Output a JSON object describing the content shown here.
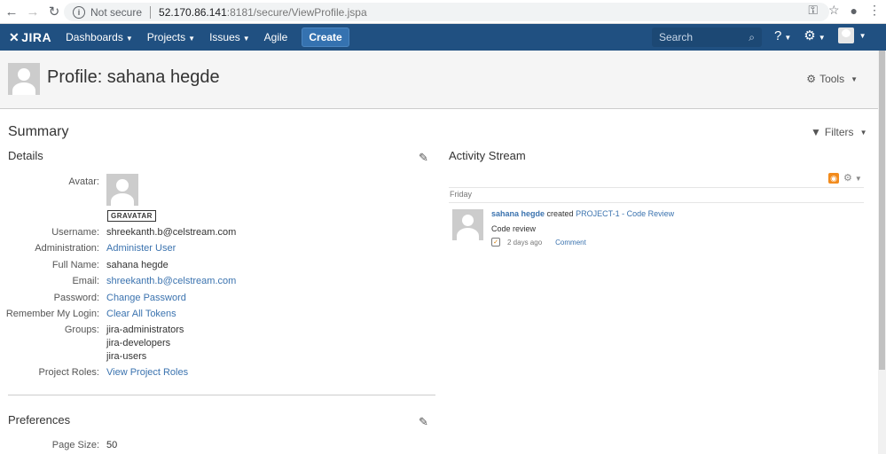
{
  "browser": {
    "not_secure": "Not secure",
    "host": "52.170.86.141",
    "path": ":8181/secure/ViewProfile.jspa"
  },
  "nav": {
    "logo": "JIRA",
    "items": [
      "Dashboards",
      "Projects",
      "Issues",
      "Agile"
    ],
    "create": "Create",
    "search_placeholder": "Search"
  },
  "profile": {
    "title": "Profile: sahana hegde",
    "tools": "Tools"
  },
  "summary": {
    "heading": "Summary",
    "filters": "Filters",
    "details_heading": "Details",
    "avatar_label": "Avatar:",
    "gravatar": "GRAVATAR",
    "fields": {
      "username_label": "Username:",
      "username": "shreekanth.b@celstream.com",
      "admin_label": "Administration:",
      "admin": "Administer User",
      "fullname_label": "Full Name:",
      "fullname": "sahana hegde",
      "email_label": "Email:",
      "email": "shreekanth.b@celstream.com",
      "password_label": "Password:",
      "password": "Change Password",
      "remember_label": "Remember My Login:",
      "remember": "Clear All Tokens",
      "groups_label": "Groups:",
      "groups": [
        "jira-administrators",
        "jira-developers",
        "jira-users"
      ],
      "roles_label": "Project Roles:",
      "roles": "View Project Roles"
    },
    "preferences_heading": "Preferences",
    "pagesize_label": "Page Size:",
    "pagesize": "50"
  },
  "activity": {
    "heading": "Activity Stream",
    "day": "Friday",
    "user": "sahana hegde",
    "verb": "created",
    "issue": "PROJECT-1 - Code Review",
    "description": "Code review",
    "time": "2 days ago",
    "comment": "Comment"
  },
  "colors": {
    "header": "#205081",
    "link": "#3b73af",
    "create": "#3572b0"
  }
}
